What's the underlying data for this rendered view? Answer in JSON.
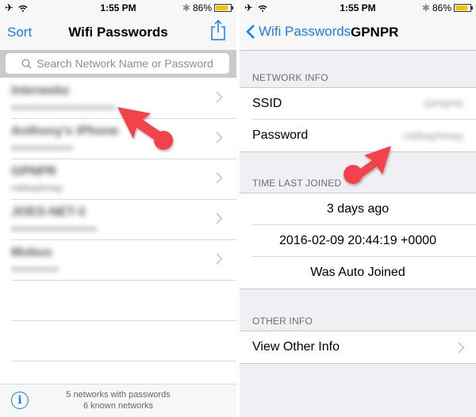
{
  "status_bar": {
    "time": "1:55 PM",
    "battery_percent": "86%",
    "battery_level": 0.86,
    "icons": [
      "airplane-icon",
      "wifi-icon",
      "bluetooth-icon",
      "battery-icon"
    ]
  },
  "left": {
    "nav": {
      "left_button": "Sort",
      "title": "Wifi Passwords",
      "right_icon": "share-icon"
    },
    "search": {
      "placeholder": "Search Network Name or Password"
    },
    "networks": [
      {
        "name": "Interwebz",
        "password": "xxxxxxxxxxxxxxxxxxxxxx"
      },
      {
        "name": "Anthony's iPhone",
        "password": "xxxxxxxxxxxxx"
      },
      {
        "name": "GPNPR",
        "password": "rxbbayhmay"
      },
      {
        "name": "JOES-NET-3",
        "password": "xxxxxxxxxxxxxxxxxx"
      },
      {
        "name": "Mobus",
        "password": "xxxxxxxxxx"
      }
    ],
    "footer": {
      "line1": "5 networks with passwords",
      "line2": "6 known networks"
    }
  },
  "right": {
    "nav": {
      "back_label": "Wifi Passwords",
      "title": "GPNPR"
    },
    "sections": {
      "network_info": {
        "header": "NETWORK INFO",
        "ssid_label": "SSID",
        "ssid_value": "GPNPR",
        "password_label": "Password",
        "password_value": "rxbbayhmay"
      },
      "time_last_joined": {
        "header": "TIME LAST JOINED",
        "relative": "3 days ago",
        "timestamp": "2016-02-09 20:44:19 +0000",
        "auto_joined": "Was Auto Joined"
      },
      "other_info": {
        "header": "OTHER INFO",
        "item": "View Other Info"
      }
    }
  },
  "colors": {
    "accent": "#147efb",
    "annotation_arrow": "#f4434b",
    "battery": "#f5c400"
  }
}
